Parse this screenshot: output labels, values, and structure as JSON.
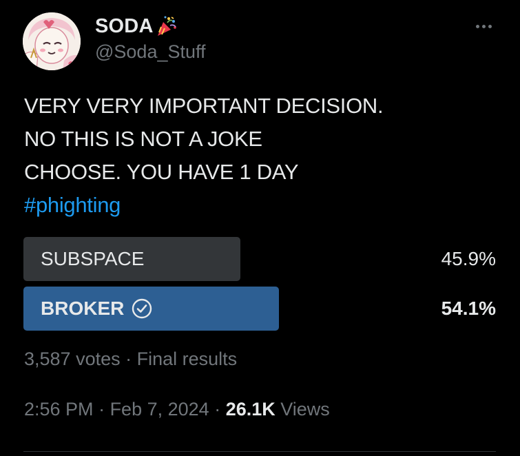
{
  "author": {
    "display_name": "SODA",
    "handle": "@Soda_Stuff"
  },
  "tweet": {
    "lines": [
      "VERY VERY IMPORTANT DECISION.",
      "NO THIS IS NOT A JOKE",
      "CHOOSE. YOU HAVE 1 DAY"
    ],
    "hashtag": "#phighting"
  },
  "poll": {
    "options": [
      {
        "label": "SUBSPACE",
        "percent_text": "45.9%",
        "percent": 45.9,
        "winner": false
      },
      {
        "label": "BROKER",
        "percent_text": "54.1%",
        "percent": 54.1,
        "winner": true
      }
    ],
    "votes": "3,587 votes",
    "separator": " · ",
    "status": "Final results"
  },
  "meta": {
    "time": "2:56 PM",
    "date": "Feb 7, 2024",
    "separator": " · ",
    "views_count": "26.1K",
    "views_label": " Views"
  },
  "colors": {
    "background": "#000000",
    "text": "#e7e9ea",
    "muted": "#71767b",
    "accent": "#1d9bf0",
    "loser_bar": "#333639",
    "winner_bar": "#2d5f93"
  },
  "icons": {
    "party": "party-popper-icon",
    "check": "check-circle-icon",
    "more": "more-horizontal-icon"
  }
}
